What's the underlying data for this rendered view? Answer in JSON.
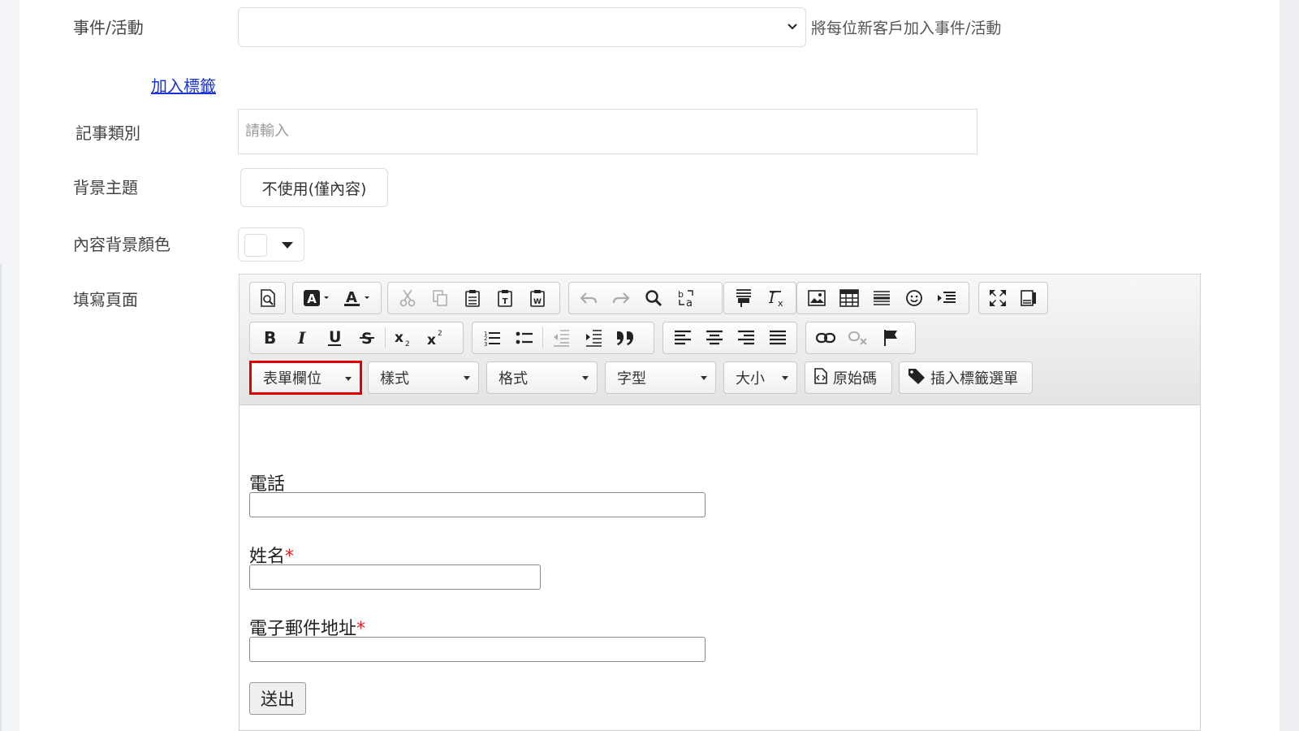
{
  "form": {
    "event_label": "事件/活動",
    "event_value": "",
    "event_hint": "將每位新客戶加入事件/活動",
    "add_tag_link": "加入標籤",
    "note_type_label": "記事類別",
    "note_type_placeholder": "請輸入",
    "bg_theme_label": "背景主題",
    "bg_theme_value": "不使用(僅內容)",
    "content_bg_color_label": "內容背景顏色",
    "content_bg_color_value": "#ffffff",
    "fill_page_label": "填寫頁面"
  },
  "toolbar": {
    "combos": {
      "form_field": "表單欄位",
      "styles": "樣式",
      "format": "格式",
      "font": "字型",
      "size": "大小"
    },
    "source_button": "原始碼",
    "insert_tag_menu_button": "插入標籤選單",
    "highlight_color": "#e00000"
  },
  "content": {
    "phone_label": "電話",
    "name_label": "姓名",
    "email_label": "電子郵件地址",
    "required_mark": "*",
    "submit_label": "送出"
  }
}
